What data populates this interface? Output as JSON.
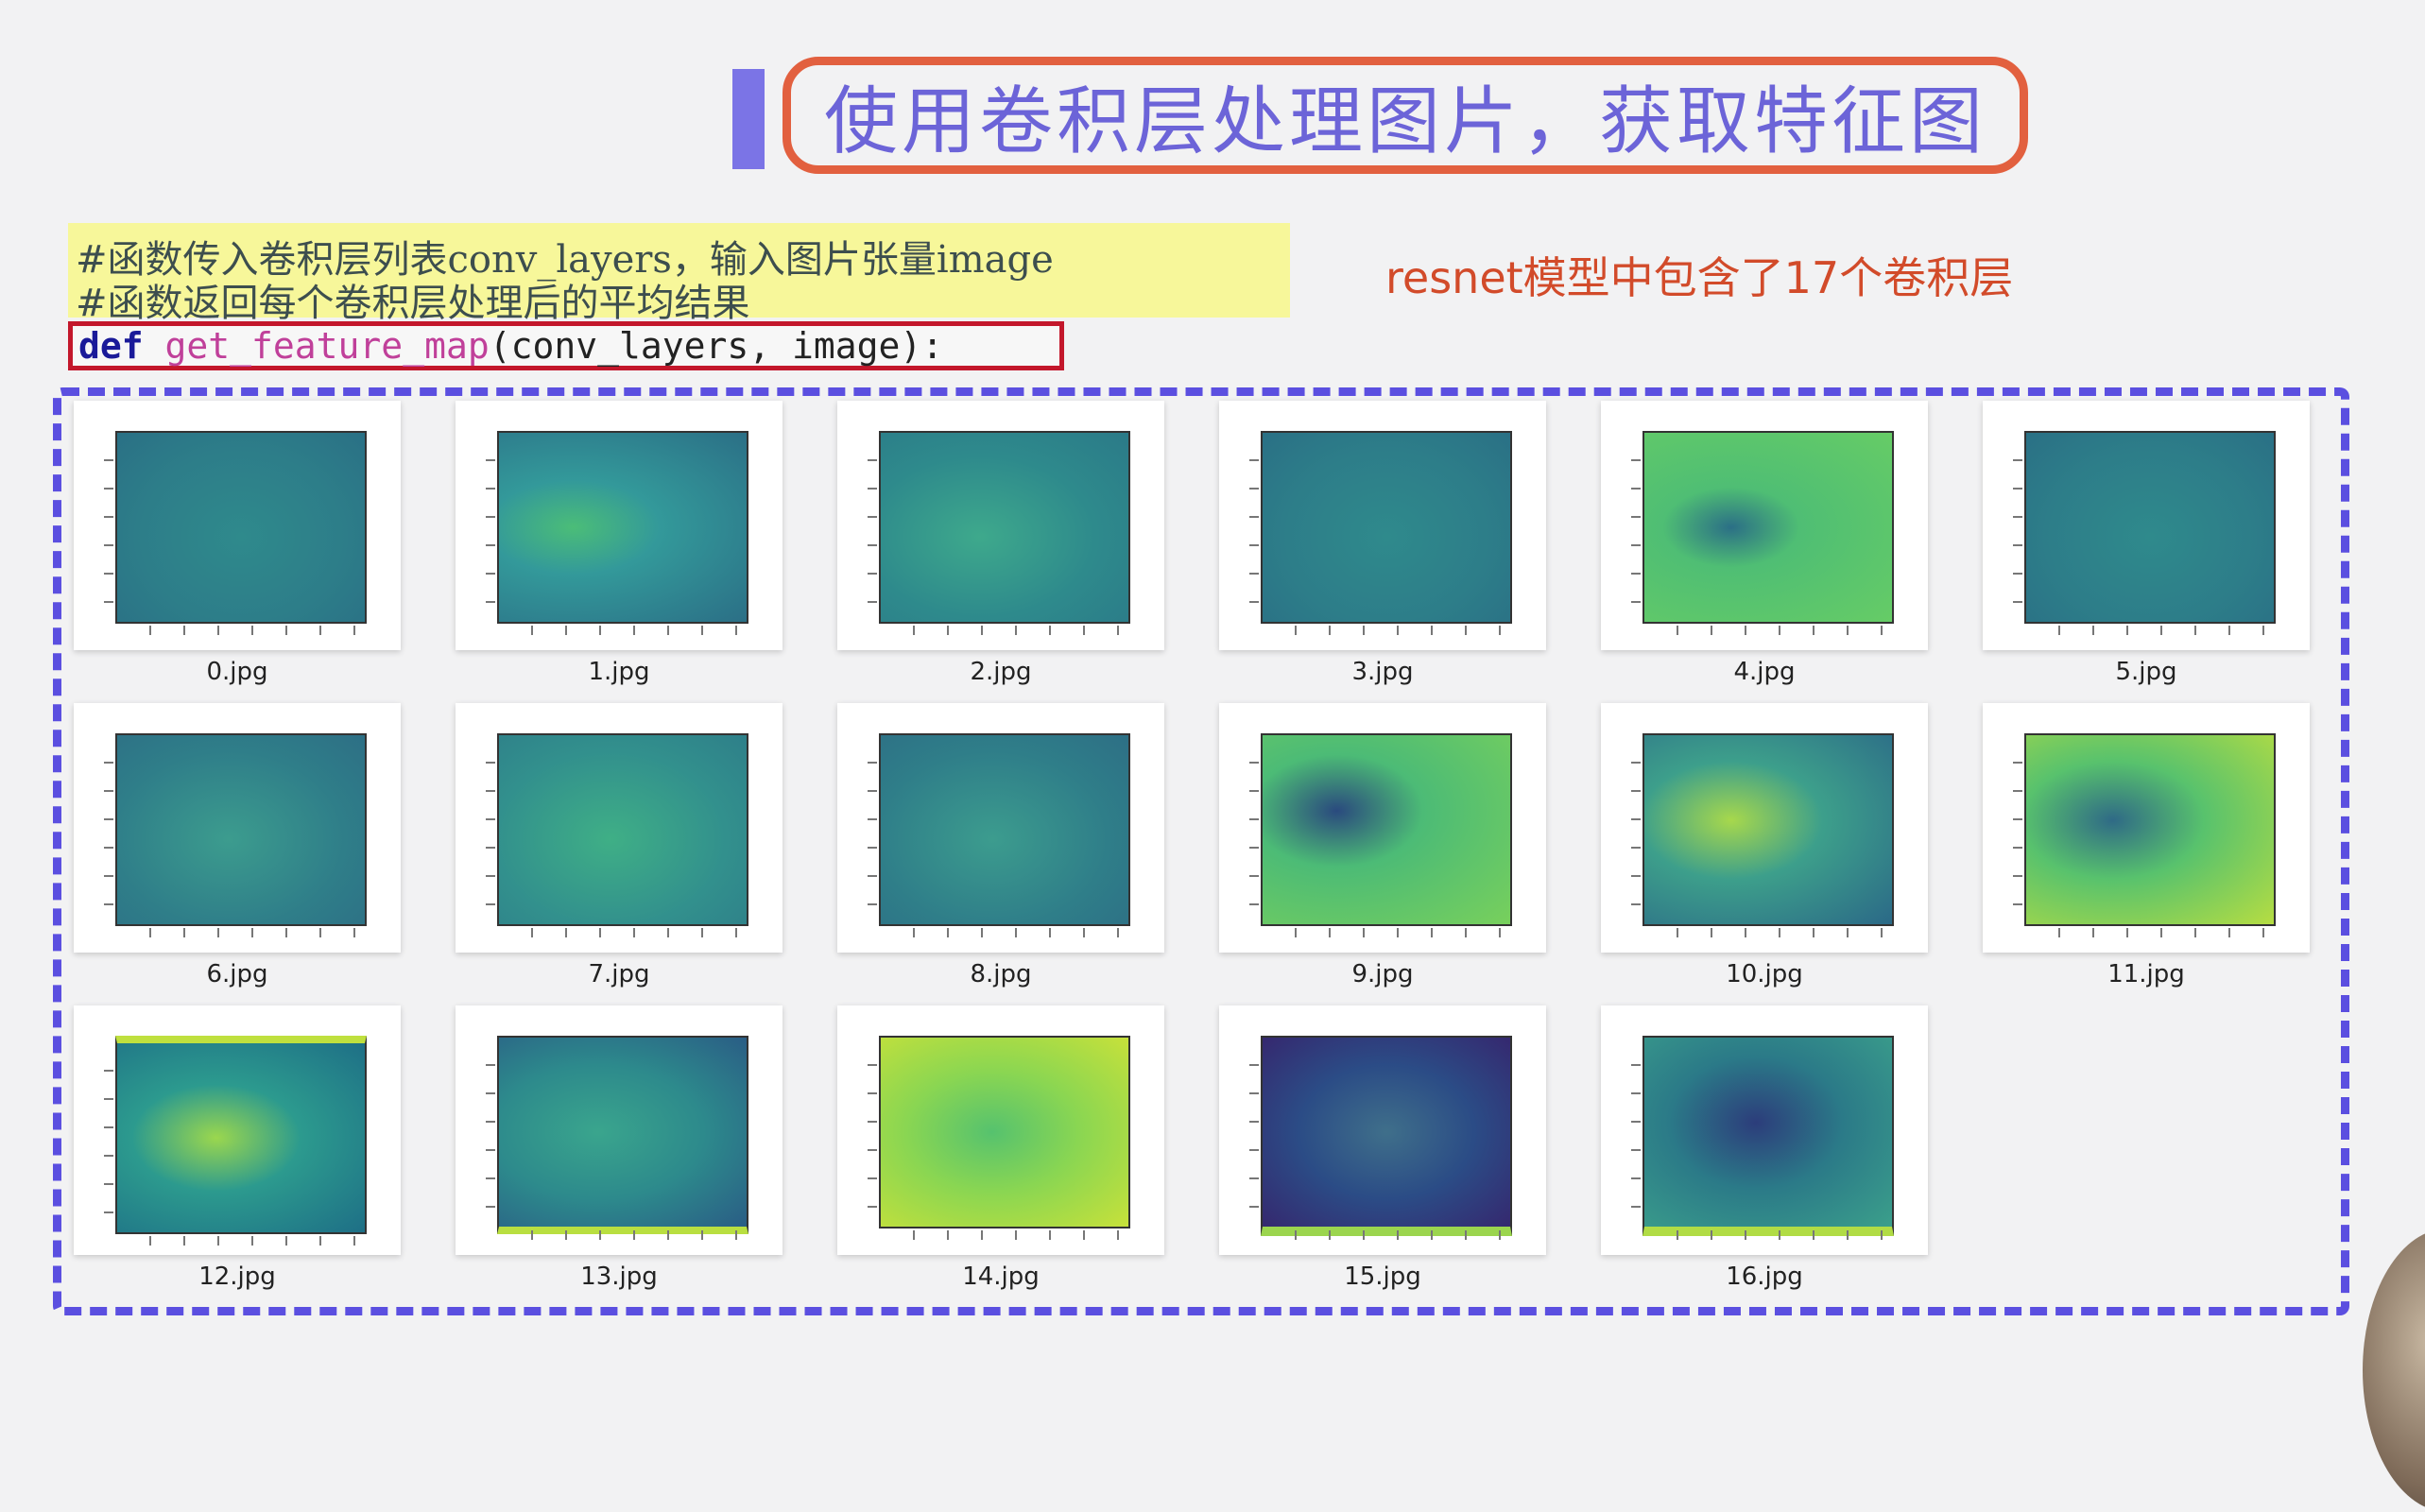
{
  "title": "使用卷积层处理图片，获取特征图",
  "comments": [
    "#函数传入卷积层列表conv_layers，输入图片张量image",
    "#函数返回每个卷积层处理后的平均结果"
  ],
  "code": {
    "keyword": "def",
    "function_name": "get_feature_map",
    "arguments": "(conv_layers, image):"
  },
  "note": "resnet模型中包含了17个卷积层",
  "feature_maps": [
    {
      "label": "0.jpg"
    },
    {
      "label": "1.jpg"
    },
    {
      "label": "2.jpg"
    },
    {
      "label": "3.jpg"
    },
    {
      "label": "4.jpg"
    },
    {
      "label": "5.jpg"
    },
    {
      "label": "6.jpg"
    },
    {
      "label": "7.jpg"
    },
    {
      "label": "8.jpg"
    },
    {
      "label": "9.jpg"
    },
    {
      "label": "10.jpg"
    },
    {
      "label": "11.jpg"
    },
    {
      "label": "12.jpg"
    },
    {
      "label": "13.jpg"
    },
    {
      "label": "14.jpg"
    },
    {
      "label": "15.jpg"
    },
    {
      "label": "16.jpg"
    }
  ],
  "colors": {
    "title_text": "#6c64d8",
    "title_border": "#e2603f",
    "accent_bar": "#7b74e6",
    "comment_bg": "#f7f79a",
    "code_border": "#c3172b",
    "note_text": "#d24b2a",
    "frame_dash": "#5b4fe0"
  }
}
